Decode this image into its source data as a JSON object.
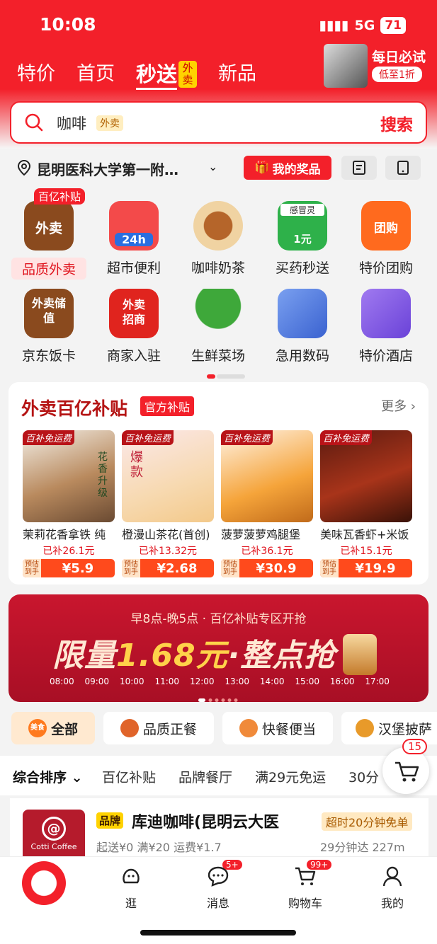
{
  "status": {
    "time": "10:08",
    "network": "5G",
    "battery": "71"
  },
  "tabs": [
    {
      "label": "特价"
    },
    {
      "label": "首页"
    },
    {
      "label": "秒送",
      "badge": "外卖"
    },
    {
      "label": "新品"
    }
  ],
  "promo": {
    "title": "每日必试",
    "subtitle": "低至1折"
  },
  "search": {
    "value": "咖啡",
    "tag": "外卖",
    "button": "搜索"
  },
  "location": {
    "text": "昆明医科大学第一附…",
    "prize_button": "我的奖品"
  },
  "categories": [
    {
      "label": "品质外卖",
      "icon_text": "外卖",
      "tag": "百亿补贴",
      "color": "#8a4a1e"
    },
    {
      "label": "超市便利",
      "icon_text": "24h",
      "color": "#f34a4a"
    },
    {
      "label": "咖啡奶茶",
      "icon_text": "",
      "color": "#c98a3e"
    },
    {
      "label": "买药秒送",
      "icon_text": "1元",
      "top_text": "感冒灵",
      "color": "#2eb14a"
    },
    {
      "label": "特价团购",
      "icon_text": "团购",
      "color": "#ff6a1e"
    },
    {
      "label": "京东饭卡",
      "icon_text": "外卖储值",
      "color": "#8a4a1e"
    },
    {
      "label": "商家入驻",
      "icon_text": "外卖招商",
      "color": "#e0241e"
    },
    {
      "label": "生鲜菜场",
      "icon_text": "",
      "color": "#3ea83a"
    },
    {
      "label": "急用数码",
      "icon_text": "",
      "color": "#4a72e0"
    },
    {
      "label": "特价酒店",
      "icon_text": "",
      "color": "#7a52e0"
    }
  ],
  "subsidy": {
    "title": "外卖百亿补贴",
    "badge": "官方补贴",
    "more": "更多 ›",
    "products": [
      {
        "tag": "百补免运费",
        "name": "茉莉花香拿铁 纯",
        "subsidy": "已补26.1元",
        "est": "预估到手",
        "price": "¥5.9",
        "img_text": "花香升级",
        "img_color": "#6a4a32"
      },
      {
        "tag": "百补免运费",
        "name": "橙漫山茶花(首创)",
        "subsidy": "已补13.32元",
        "est": "预估到手",
        "price": "¥2.68",
        "img_text": "爆款",
        "img_color": "#f3c98a"
      },
      {
        "tag": "百补免运费",
        "name": "菠萝菠萝鸡腿堡",
        "subsidy": "已补36.1元",
        "est": "预估到手",
        "price": "¥30.9",
        "img_text": "",
        "img_color": "#f5a43a"
      },
      {
        "tag": "百补免运费",
        "name": "美味瓦香虾+米饭",
        "subsidy": "已补15.1元",
        "est": "预估到手",
        "price": "¥19.9",
        "img_text": "",
        "img_color": "#8a2a18"
      }
    ]
  },
  "banner": {
    "top": "早8点-晚5点 · 百亿补贴专区开抢",
    "main_prefix": "限量",
    "main_num": "1.68元",
    "main_suffix": "·整点抢",
    "times": [
      "08:00",
      "09:00",
      "10:00",
      "11:00",
      "12:00",
      "13:00",
      "14:00",
      "15:00",
      "16:00",
      "17:00"
    ]
  },
  "chips": [
    {
      "label": "全部",
      "icon_text": "美食"
    },
    {
      "label": "品质正餐"
    },
    {
      "label": "快餐便当"
    },
    {
      "label": "汉堡披萨"
    }
  ],
  "sort": [
    "综合排序 ⌄",
    "百亿补贴",
    "品牌餐厅",
    "满29元免运",
    "30分"
  ],
  "cart_count": "15",
  "store": {
    "logo_text": "Cotti Coffee",
    "tag": "品牌",
    "name": "库迪咖啡(昆明云大医",
    "promo": "超时20分钟免单",
    "meta": "起送¥0  满¥20 运费¥1.7",
    "delivery": "29分钟达  227m"
  },
  "nav": [
    {
      "label": "",
      "icon": "jd-mascot-icon"
    },
    {
      "label": "逛",
      "icon": "browse-icon"
    },
    {
      "label": "消息",
      "icon": "message-icon",
      "badge": "5+"
    },
    {
      "label": "购物车",
      "icon": "cart-icon",
      "badge": "99+"
    },
    {
      "label": "我的",
      "icon": "profile-icon"
    }
  ],
  "colors": {
    "brand": "#f3202a",
    "subsidy_title": "#b51414",
    "price": "#ff4a1c"
  }
}
